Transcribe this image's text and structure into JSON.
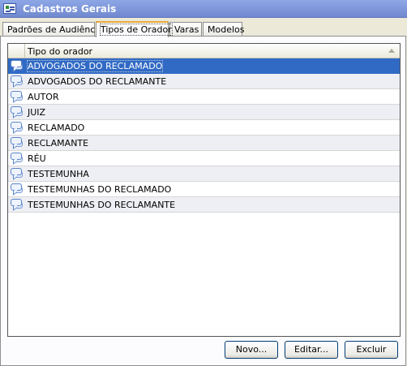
{
  "window": {
    "title": "Cadastros Gerais"
  },
  "tabs": [
    {
      "label": "Padrões de Audiência"
    },
    {
      "label": "Tipos de Orador"
    },
    {
      "label": "Varas"
    },
    {
      "label": "Modelos"
    }
  ],
  "active_tab": "Tipos de Orador",
  "table": {
    "column_header": "Tipo do orador",
    "row_icon": "speech-bubbles-icon",
    "rows": [
      {
        "label": "ADVOGADOS DO RECLAMADO"
      },
      {
        "label": "ADVOGADOS DO RECLAMANTE"
      },
      {
        "label": "AUTOR"
      },
      {
        "label": "JUIZ"
      },
      {
        "label": "RECLAMADO"
      },
      {
        "label": "RECLAMANTE"
      },
      {
        "label": "RÉU"
      },
      {
        "label": "TESTEMUNHA"
      },
      {
        "label": "TESTEMUNHAS DO RECLAMADO"
      },
      {
        "label": "TESTEMUNHAS DO RECLAMANTE"
      }
    ],
    "selected_row": "ADVOGADOS DO RECLAMADO"
  },
  "buttons": {
    "novo": "Novo...",
    "editar": "Editar...",
    "excluir": "Excluir"
  },
  "colors": {
    "title_bar": "#7a96df",
    "selection": "#316ac5",
    "active_tab_accent": "#e8a93b"
  }
}
